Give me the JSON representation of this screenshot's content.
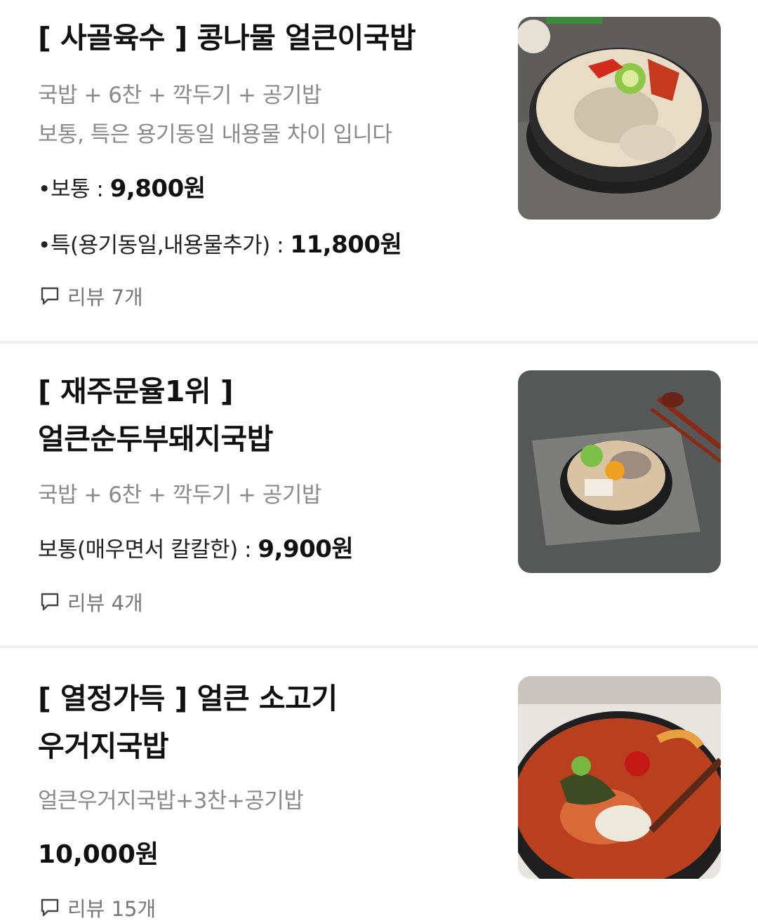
{
  "items": [
    {
      "title_lines": [
        "[ 사골육수 ] 콩나물 얼큰이국밥"
      ],
      "desc_lines": [
        "국밥 + 6찬 + 깍두기 + 공기밥",
        "보통, 특은 용기동일 내용물 차이 입니다"
      ],
      "prices": [
        {
          "bullet": "•",
          "label": "보통 : ",
          "amount": "9,800원"
        },
        {
          "bullet": "•",
          "label": "특(용기동일,내용물추가) : ",
          "amount": "11,800원"
        }
      ],
      "review": "리뷰 7개",
      "image_icon": "soybean-sprout-gukbap-photo"
    },
    {
      "title_lines": [
        "[ 재주문율1위 ]",
        "얼큰순두부돼지국밥"
      ],
      "desc_lines": [
        "국밥 + 6찬 + 깍두기 + 공기밥"
      ],
      "prices": [
        {
          "bullet": "",
          "label": "보통(매우면서 칼칼한) : ",
          "amount": "9,900원"
        }
      ],
      "review": "리뷰 4개",
      "image_icon": "sundubu-pork-gukbap-photo"
    },
    {
      "title_lines": [
        "[ 열정가득 ] 얼큰 소고기",
        "우거지국밥"
      ],
      "desc_lines": [
        "얼큰우거지국밥+3찬+공기밥"
      ],
      "price_only": "10,000원",
      "review": "리뷰 15개",
      "image_icon": "beef-ugeoji-gukbap-photo"
    }
  ]
}
